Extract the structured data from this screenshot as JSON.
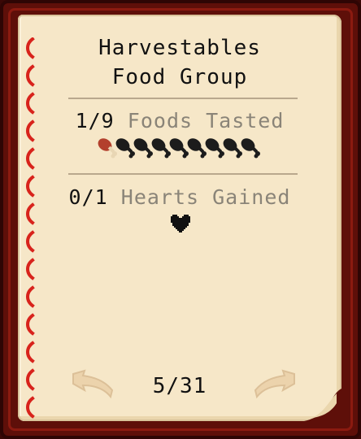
{
  "panel": {
    "title_line1": "Harvestables",
    "title_line2": "Food Group"
  },
  "foods": {
    "count": "1/9",
    "label": "Foods Tasted",
    "tasted": 1,
    "total": 9,
    "icon": "drumstick-icon"
  },
  "hearts": {
    "count": "0/1",
    "label": "Hearts Gained",
    "icon": "heart-icon"
  },
  "pagination": {
    "current": "5/31",
    "prev_icon": "arrow-left-icon",
    "next_icon": "arrow-right-icon"
  },
  "colors": {
    "frame": "#5e0f09",
    "paper": "#f6e7c8",
    "binding": "#d8231c",
    "tasted_meat": "#b3402d",
    "untasted": "#1c1c1c"
  }
}
